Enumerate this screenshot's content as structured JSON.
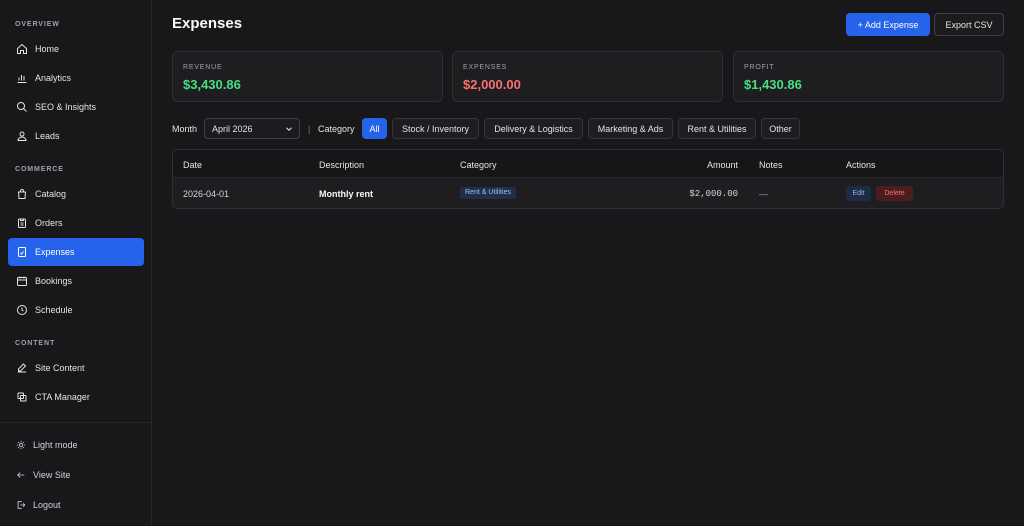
{
  "sidebar": {
    "sections": [
      {
        "label": "OVERVIEW",
        "items": [
          {
            "label": "Home",
            "icon": "home-icon"
          },
          {
            "label": "Analytics",
            "icon": "bar-chart-icon"
          },
          {
            "label": "SEO & Insights",
            "icon": "search-icon"
          },
          {
            "label": "Leads",
            "icon": "user-icon"
          }
        ]
      },
      {
        "label": "COMMERCE",
        "items": [
          {
            "label": "Catalog",
            "icon": "shopping-bag-icon"
          },
          {
            "label": "Orders",
            "icon": "clipboard-icon"
          },
          {
            "label": "Expenses",
            "icon": "receipt-icon",
            "active": true
          },
          {
            "label": "Bookings",
            "icon": "calendar-icon"
          },
          {
            "label": "Schedule",
            "icon": "clock-icon"
          }
        ]
      },
      {
        "label": "CONTENT",
        "items": [
          {
            "label": "Site Content",
            "icon": "edit-icon"
          },
          {
            "label": "CTA Manager",
            "icon": "layers-icon"
          }
        ]
      }
    ],
    "bottom": [
      {
        "label": "Light mode",
        "icon": "sun-icon"
      },
      {
        "label": "View Site",
        "icon": "arrow-left-icon"
      },
      {
        "label": "Logout",
        "icon": "logout-icon"
      }
    ]
  },
  "header": {
    "title": "Expenses",
    "add_label": "+ Add Expense",
    "export_label": "Export CSV"
  },
  "stats": [
    {
      "label": "REVENUE",
      "value": "$3,430.86",
      "color": "#4ade80"
    },
    {
      "label": "EXPENSES",
      "value": "$2,000.00",
      "color": "#f87171"
    },
    {
      "label": "PROFIT",
      "value": "$1,430.86",
      "color": "#4ade80"
    }
  ],
  "filters": {
    "month_label": "Month",
    "month_value": "April 2026",
    "separator": "|",
    "category_label": "Category",
    "categories": [
      "All",
      "Stock / Inventory",
      "Delivery & Logistics",
      "Marketing & Ads",
      "Rent & Utilities",
      "Other"
    ],
    "active_category": "All"
  },
  "table": {
    "columns": [
      "Date",
      "Description",
      "Category",
      "Amount",
      "Notes",
      "Actions"
    ],
    "rows": [
      {
        "date": "2026-04-01",
        "description": "Monthly rent",
        "category": "Rent & Utilities",
        "amount": "$2,000.00",
        "notes": "—",
        "edit": "Edit",
        "delete": "Delete"
      }
    ]
  },
  "colors": {
    "accent": "#2563eb",
    "positive": "#4ade80",
    "negative": "#f87171"
  }
}
